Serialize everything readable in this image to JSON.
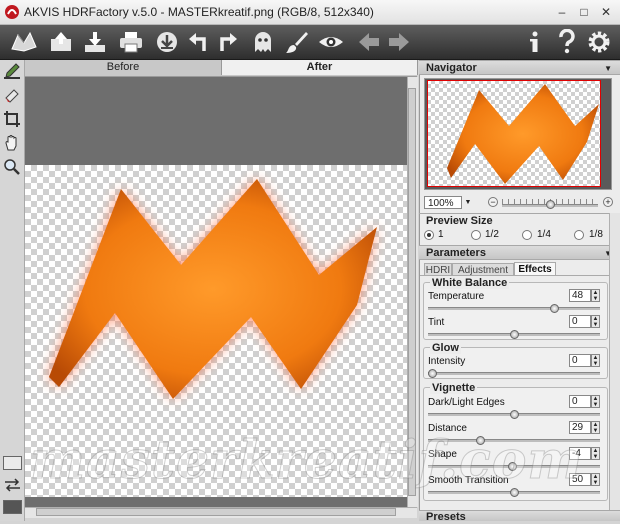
{
  "window": {
    "title": "AKVIS HDRFactory v.5.0 - MASTERkreatif.png (RGB/8, 512x340)",
    "minimize": "–",
    "maximize": "□",
    "close": "✕"
  },
  "toolbar": {
    "icons": [
      "logo-icon",
      "open-icon",
      "save-icon",
      "print-icon",
      "share-icon",
      "undo-icon",
      "redo-icon",
      "ghost-icon",
      "brush-icon",
      "eye-icon",
      "back-icon",
      "forward-icon",
      "info-icon",
      "help-icon",
      "settings-icon"
    ]
  },
  "tabs": {
    "before": "Before",
    "after": "After"
  },
  "navigator": {
    "title": "Navigator",
    "zoom": "100%",
    "zoom_minus": "−",
    "zoom_plus": "+",
    "zoom_slider": 0.5
  },
  "preview_size": {
    "title": "Preview Size",
    "options": [
      "1",
      "1/2",
      "1/4",
      "1/8"
    ],
    "selected": "1"
  },
  "parameters": {
    "title": "Parameters",
    "tabs": [
      "HDRI",
      "Adjustment",
      "Effects"
    ],
    "active_tab": "Effects",
    "white_balance": {
      "title": "White Balance",
      "temperature_label": "Temperature",
      "temperature": "48",
      "tint_label": "Tint",
      "tint": "0"
    },
    "glow": {
      "title": "Glow",
      "intensity_label": "Intensity",
      "intensity": "0"
    },
    "vignette": {
      "title": "Vignette",
      "edges_label": "Dark/Light Edges",
      "edges": "0",
      "distance_label": "Distance",
      "distance": "29",
      "shape_label": "Shape",
      "shape": "-4",
      "smooth_label": "Smooth Transition",
      "smooth": "50"
    }
  },
  "presets": {
    "title": "Presets"
  },
  "watermark": "masterkreatif.com",
  "colors": {
    "toolbar": "#3c3c3c",
    "shape_orange": "#e8740e",
    "canvas_gray": "#6e6e6e"
  }
}
